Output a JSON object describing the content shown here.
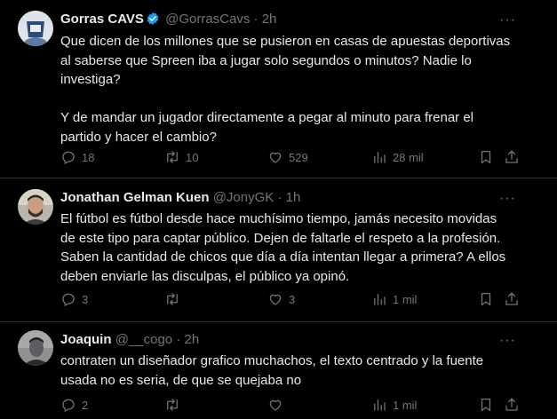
{
  "tweets": [
    {
      "name": "Gorras CAVS",
      "handle": "@GorrasCavs",
      "dot": "·",
      "time": "2h",
      "verified": true,
      "text": "Que dicen de los millones que se pusieron en casas de apuestas deportivas\nal saberse que Spreen iba a jugar solo segundos o minutos? Nadie lo\ninvestiga?\n\nY de mandar un jugador directamente a pegar al minuto para frenar el\npartido y hacer el cambio?",
      "replies": "18",
      "retweets": "10",
      "likes": "529",
      "views": "28 mil"
    },
    {
      "name": "Jonathan Gelman Kuen",
      "handle": "@JonyGK",
      "dot": "·",
      "time": "1h",
      "verified": false,
      "text": "El fútbol es fútbol desde hace muchísimo tiempo, jamás necesito movidas\nde este tipo para captar público. Dejen de faltarle el respeto a la profesión.\nSaben la cantidad de chicos que día a día intentan llegar a primera? A ellos\ndeben enviarle las disculpas, el público ya opinó.",
      "replies": "3",
      "retweets": "",
      "likes": "3",
      "views": "1 mil"
    },
    {
      "name": "Joaquin",
      "handle": "@__cogo",
      "dot": "·",
      "time": "2h",
      "verified": false,
      "text": "contraten un diseñador grafico muchachos, el texto centrado y la fuente\nusada no es seria, de que se quejaba no",
      "replies": "2",
      "retweets": "",
      "likes": "",
      "views": "1 mil"
    }
  ],
  "colors": {
    "background": "#000000",
    "text": "#e7e9ea",
    "muted": "#71767b",
    "divider": "#2f3336",
    "verified": "#1d9bf0"
  },
  "icons": [
    "more-icon",
    "reply-icon",
    "retweet-icon",
    "like-icon",
    "views-icon",
    "bookmark-icon",
    "share-icon",
    "verified-badge-icon"
  ]
}
